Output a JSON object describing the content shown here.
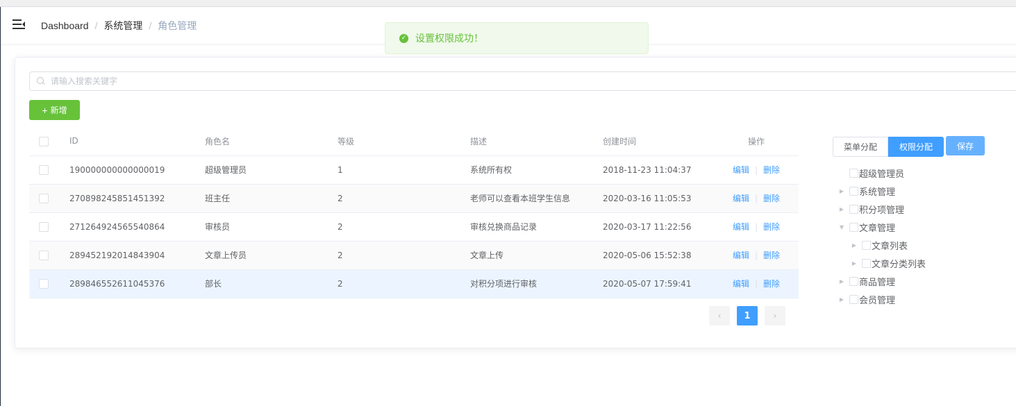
{
  "breadcrumb": {
    "home": "Dashboard",
    "section": "系统管理",
    "current": "角色管理",
    "separator": "/"
  },
  "toast": {
    "message": "设置权限成功！",
    "icon": "success-check-icon",
    "color": "#67c23a"
  },
  "search": {
    "placeholder": "请输入搜索关键字",
    "value": ""
  },
  "toolbar": {
    "add_label": "新增",
    "add_color": "#67c23a"
  },
  "table": {
    "headers": {
      "id": "ID",
      "name": "角色名",
      "level": "等级",
      "desc": "描述",
      "created": "创建时间",
      "ops": "操作"
    },
    "rows": [
      {
        "id": "190000000000000019",
        "name": "超级管理员",
        "level": "1",
        "desc": "系统所有权",
        "created": "2018-11-23 11:04:37"
      },
      {
        "id": "270898245851451392",
        "name": "班主任",
        "level": "2",
        "desc": "老师可以查看本班学生信息",
        "created": "2020-03-16 11:05:53"
      },
      {
        "id": "271264924565540864",
        "name": "审核员",
        "level": "2",
        "desc": "审核兑换商品记录",
        "created": "2020-03-17 11:22:56"
      },
      {
        "id": "289452192014843904",
        "name": "文章上传员",
        "level": "2",
        "desc": "文章上传",
        "created": "2020-05-06 15:52:38"
      },
      {
        "id": "289846552611045376",
        "name": "部长",
        "level": "2",
        "desc": "对积分项进行审核",
        "created": "2020-05-07 17:59:41"
      }
    ],
    "edit_label": "编辑",
    "delete_label": "删除",
    "op_separator": "|"
  },
  "pagination": {
    "current_page": "1",
    "prev": "‹",
    "next": "›"
  },
  "permissions": {
    "tab_menu": "菜单分配",
    "tab_perm": "权限分配",
    "save_label": "保存",
    "accent": "#409eff",
    "tree": [
      {
        "label": "超级管理员",
        "arrow": "",
        "indent": 0
      },
      {
        "label": "系统管理",
        "arrow": "▶",
        "indent": 0
      },
      {
        "label": "积分项管理",
        "arrow": "▶",
        "indent": 0
      },
      {
        "label": "文章管理",
        "arrow": "▼",
        "indent": 0
      },
      {
        "label": "文章列表",
        "arrow": "▶",
        "indent": 1
      },
      {
        "label": "文章分类列表",
        "arrow": "▶",
        "indent": 1
      },
      {
        "label": "商品管理",
        "arrow": "▶",
        "indent": 0
      },
      {
        "label": "会员管理",
        "arrow": "▶",
        "indent": 0
      }
    ]
  }
}
